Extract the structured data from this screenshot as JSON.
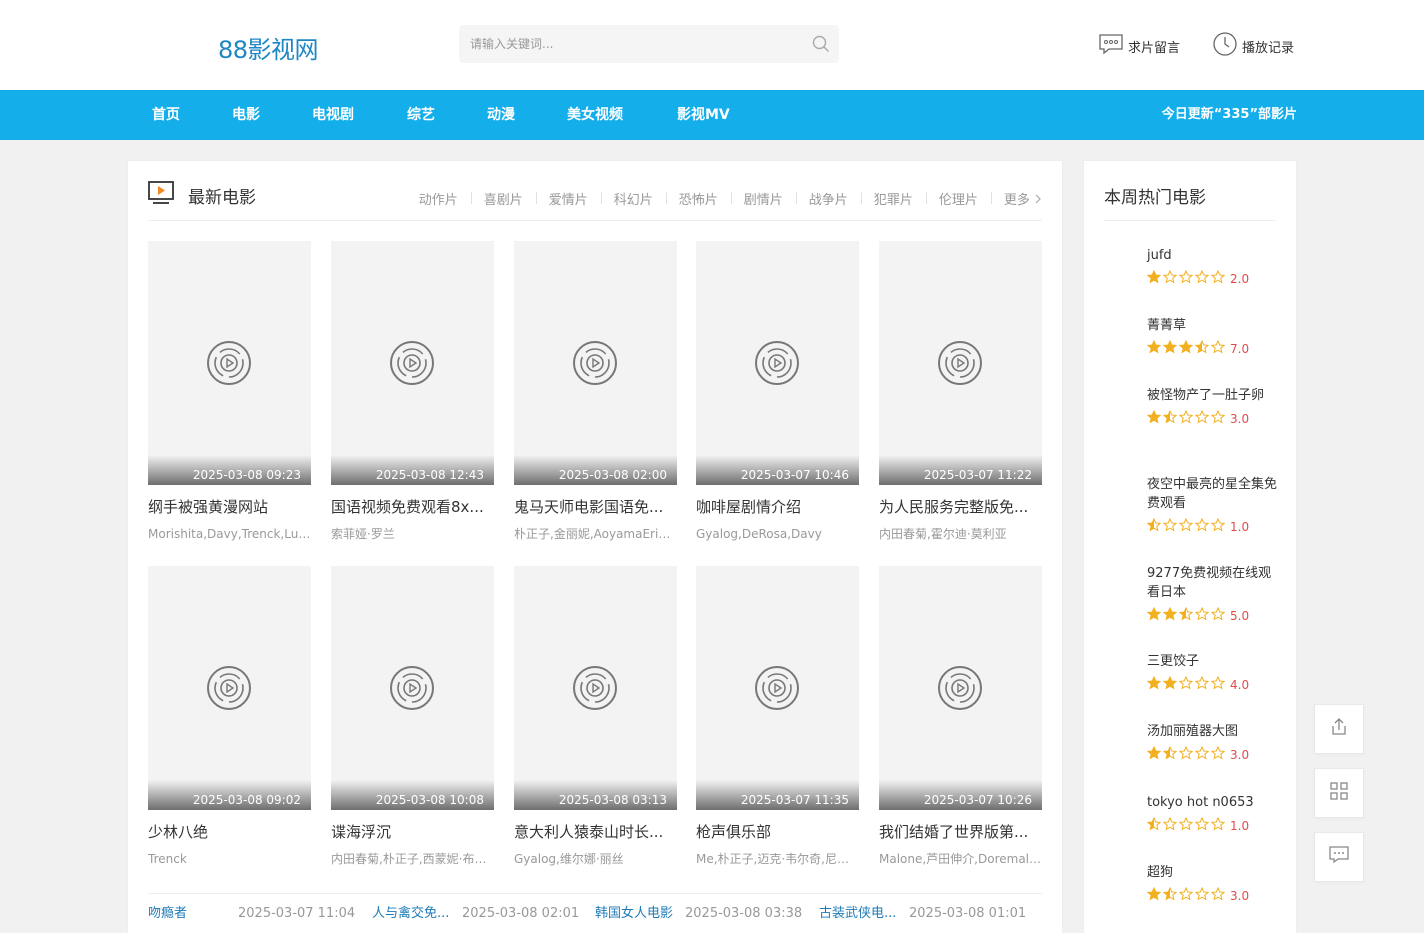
{
  "header": {
    "logo": "88影视网",
    "search_placeholder": "请输入关键词...",
    "links": [
      {
        "label": "求片留言",
        "icon": "message-icon"
      },
      {
        "label": "播放记录",
        "icon": "clock-icon"
      }
    ]
  },
  "nav": {
    "items": [
      "首页",
      "电影",
      "电视剧",
      "综艺",
      "动漫",
      "美女视频",
      "影视MV"
    ],
    "update_text": "今日更新“335”部影片"
  },
  "main": {
    "title": "最新电影",
    "categories": [
      "动作片",
      "喜剧片",
      "爱情片",
      "科幻片",
      "恐怖片",
      "剧情片",
      "战争片",
      "犯罪片",
      "伦理片",
      "更多"
    ],
    "cards": [
      {
        "title": "纲手被强黄漫网站",
        "cast": "Morishita,Davy,Trenck,Lulu...",
        "date": "2025-03-08 09:23"
      },
      {
        "title": "国语视频免费观看8x...",
        "cast": "索菲娅·罗兰",
        "date": "2025-03-08 12:43"
      },
      {
        "title": "鬼马天师电影国语免...",
        "cast": "朴正子,金丽妮,AoyamaErin...",
        "date": "2025-03-08 02:00"
      },
      {
        "title": "咖啡屋剧情介绍",
        "cast": "Gyalog,DeRosa,Davy",
        "date": "2025-03-07 10:46"
      },
      {
        "title": "为人民服务完整版免...",
        "cast": "内田春菊,霍尔迪·莫利亚",
        "date": "2025-03-07 11:22"
      },
      {
        "title": "少林八绝",
        "cast": "Trenck",
        "date": "2025-03-08 09:02"
      },
      {
        "title": "谍海浮沉",
        "cast": "内田春菊,朴正子,西蒙妮·布奇...",
        "date": "2025-03-08 10:08"
      },
      {
        "title": "意大利人猿泰山时长...",
        "cast": "Gyalog,维尔娜·丽丝",
        "date": "2025-03-08 03:13"
      },
      {
        "title": "枪声俱乐部",
        "cast": "Me,朴正子,迈克·韦尔奇,尼古...",
        "date": "2025-03-07 11:35"
      },
      {
        "title": "我们结婚了世界版第...",
        "cast": "Malone,芦田伸介,Doremale...",
        "date": "2025-03-07 10:26"
      }
    ],
    "text_list": [
      {
        "title": "吻瘾者",
        "date": "2025-03-07 11:04"
      },
      {
        "title": "人与禽交免...",
        "date": "2025-03-08 02:01"
      },
      {
        "title": "韩国女人电影",
        "date": "2025-03-08 03:38"
      },
      {
        "title": "古装武侠电...",
        "date": "2025-03-08 01:01"
      }
    ]
  },
  "side": {
    "title": "本周热门电影",
    "items": [
      {
        "name": "jufd",
        "score": "2.0",
        "stars": 1
      },
      {
        "name": "菁菁草",
        "score": "7.0",
        "stars": 3.5
      },
      {
        "name": "被怪物产了一肚子卵",
        "score": "3.0",
        "stars": 1.5
      },
      {
        "name": "夜空中最亮的星全集免费观看",
        "score": "1.0",
        "stars": 0.5
      },
      {
        "name": "9277免费视频在线观看日本",
        "score": "5.0",
        "stars": 2.5
      },
      {
        "name": "三更饺子",
        "score": "4.0",
        "stars": 2
      },
      {
        "name": "汤加丽殖器大图",
        "score": "3.0",
        "stars": 1.5
      },
      {
        "name": "tokyo hot n0653",
        "score": "1.0",
        "stars": 0.5
      },
      {
        "name": "超狗",
        "score": "3.0",
        "stars": 1.5
      }
    ]
  },
  "float_buttons": [
    "share-icon",
    "qrcode-icon",
    "comment-icon"
  ],
  "colors": {
    "nav": "#14aeea",
    "logo": "#1e86c4",
    "score": "#e34b4b",
    "star": "#f2b01e"
  }
}
